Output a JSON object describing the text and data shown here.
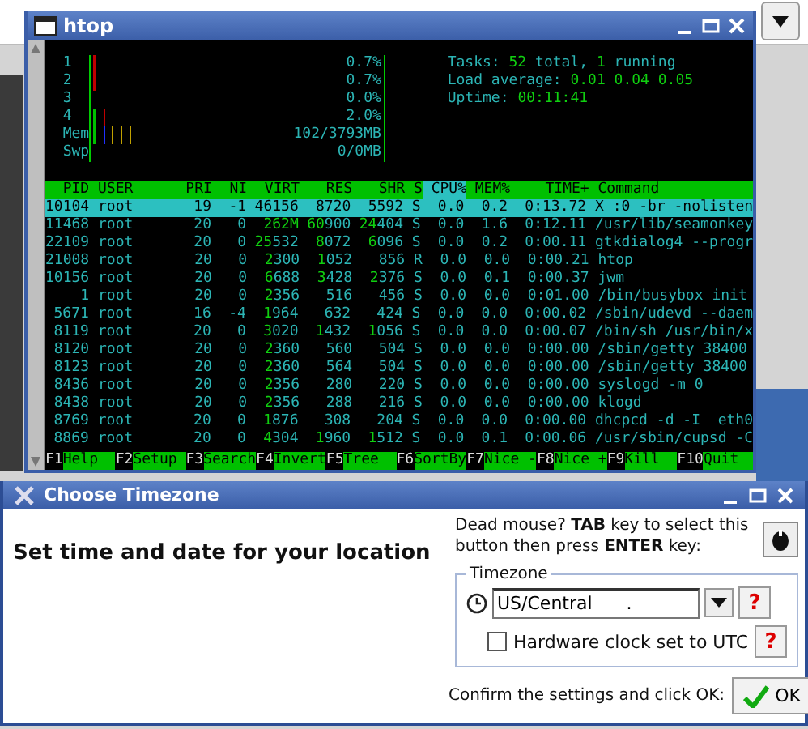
{
  "htop": {
    "title": "htop",
    "meters": [
      {
        "label": "1",
        "value": "0.7%",
        "segments": [
          {
            "color": "#c00000",
            "level": 0.03
          }
        ]
      },
      {
        "label": "2",
        "value": "0.7%",
        "segments": [
          {
            "color": "#c00000",
            "level": 0.03
          }
        ]
      },
      {
        "label": "3",
        "value": "0.0%"
      },
      {
        "label": "4",
        "value": "2.0%",
        "segments": [
          {
            "color": "#00c000",
            "level": 0.03
          },
          {
            "color": "#c00000",
            "level": 0.03
          }
        ]
      },
      {
        "label": "Mem",
        "value": "102/3793MB",
        "segments": [
          {
            "color": "#00c000",
            "level": 0.03
          },
          {
            "color": "#2030ff",
            "level": 0.03
          },
          {
            "color": "#c0a000",
            "level": 0.09
          }
        ]
      },
      {
        "label": "Swp",
        "value": "0/0MB"
      }
    ],
    "summary": [
      "Tasks: **52** total, **1** running",
      "Load average: **0.01 0.04 0.05**",
      "Uptime: **00:11:41**"
    ],
    "columns": [
      {
        "label": "PID",
        "sorted": false
      },
      {
        "label": "USER",
        "sorted": false
      },
      {
        "label": "PRI",
        "sorted": false
      },
      {
        "label": "NI",
        "sorted": false
      },
      {
        "label": "VIRT",
        "sorted": false
      },
      {
        "label": "RES",
        "sorted": false
      },
      {
        "label": "SHR",
        "sorted": false
      },
      {
        "label": "S",
        "sorted": false
      },
      {
        "label": "CPU%",
        "sorted": true
      },
      {
        "label": "MEM%",
        "sorted": false
      },
      {
        "label": "TIME+",
        "sorted": false
      },
      {
        "label": "Command",
        "sorted": false
      }
    ],
    "rows": [
      {
        "selected": true,
        "cells": [
          "10104",
          "root",
          "19",
          "-1",
          "46156",
          "8720",
          "5592",
          "S",
          "0.0",
          "0.2",
          "0:13.72",
          "X :0 -br -nolisten"
        ]
      },
      {
        "selected": false,
        "cells": [
          "11468",
          "root",
          "20",
          "0",
          "**262M**",
          "**60**900",
          "**24**404",
          "S",
          "0.0",
          "1.6",
          "0:12.11",
          "/usr/lib/seamonkey"
        ]
      },
      {
        "selected": false,
        "cells": [
          "22109",
          "root",
          "20",
          "0",
          "**25**532",
          "**8**072",
          "**6**096",
          "S",
          "0.0",
          "0.2",
          "0:00.11",
          "gtkdialog4 --progr"
        ]
      },
      {
        "selected": false,
        "cells": [
          "21008",
          "root",
          "20",
          "0",
          "**2**300",
          "**1**052",
          "856",
          "R",
          "0.0",
          "0.0",
          "0:00.21",
          "htop"
        ]
      },
      {
        "selected": false,
        "cells": [
          "10156",
          "root",
          "20",
          "0",
          "**6**688",
          "**3**428",
          "**2**376",
          "S",
          "0.0",
          "0.1",
          "0:00.37",
          "jwm"
        ]
      },
      {
        "selected": false,
        "cells": [
          "1",
          "root",
          "20",
          "0",
          "**2**356",
          "516",
          "456",
          "S",
          "0.0",
          "0.0",
          "0:01.00",
          "/bin/busybox init"
        ]
      },
      {
        "selected": false,
        "cells": [
          "5671",
          "root",
          "16",
          "-4",
          "**1**964",
          "632",
          "424",
          "S",
          "0.0",
          "0.0",
          "0:00.02",
          "/sbin/udevd --daem"
        ]
      },
      {
        "selected": false,
        "cells": [
          "8119",
          "root",
          "20",
          "0",
          "**3**020",
          "**1**432",
          "**1**056",
          "S",
          "0.0",
          "0.0",
          "0:00.07",
          "/bin/sh /usr/bin/x"
        ]
      },
      {
        "selected": false,
        "cells": [
          "8120",
          "root",
          "20",
          "0",
          "**2**360",
          "560",
          "504",
          "S",
          "0.0",
          "0.0",
          "0:00.00",
          "/sbin/getty 38400"
        ]
      },
      {
        "selected": false,
        "cells": [
          "8123",
          "root",
          "20",
          "0",
          "**2**360",
          "564",
          "504",
          "S",
          "0.0",
          "0.0",
          "0:00.00",
          "/sbin/getty 38400"
        ]
      },
      {
        "selected": false,
        "cells": [
          "8436",
          "root",
          "20",
          "0",
          "**2**356",
          "280",
          "220",
          "S",
          "0.0",
          "0.0",
          "0:00.00",
          "syslogd -m 0"
        ]
      },
      {
        "selected": false,
        "cells": [
          "8438",
          "root",
          "20",
          "0",
          "**2**356",
          "288",
          "216",
          "S",
          "0.0",
          "0.0",
          "0:00.00",
          "klogd"
        ]
      },
      {
        "selected": false,
        "cells": [
          "8769",
          "root",
          "20",
          "0",
          "**1**876",
          "308",
          "204",
          "S",
          "0.0",
          "0.0",
          "0:00.00",
          "dhcpcd -d -I  eth0"
        ]
      },
      {
        "selected": false,
        "cells": [
          "8869",
          "root",
          "20",
          "0",
          "**4**304",
          "**1**960",
          "**1**512",
          "S",
          "0.0",
          "0.1",
          "0:00.06",
          "/usr/sbin/cupsd -C"
        ]
      }
    ],
    "function_keys": [
      {
        "key": "F1",
        "label": "Help"
      },
      {
        "key": "F2",
        "label": "Setup"
      },
      {
        "key": "F3",
        "label": "Search"
      },
      {
        "key": "F4",
        "label": "Invert"
      },
      {
        "key": "F5",
        "label": "Tree"
      },
      {
        "key": "F6",
        "label": "SortBy"
      },
      {
        "key": "F7",
        "label": "Nice -"
      },
      {
        "key": "F8",
        "label": "Nice +"
      },
      {
        "key": "F9",
        "label": "Kill"
      },
      {
        "key": "F10",
        "label": "Quit"
      }
    ]
  },
  "dialog": {
    "title": "Choose Timezone",
    "heading": "Set time and date for your location",
    "hint": "Dead mouse? **TAB** key to select this button then press **ENTER** key:",
    "group": {
      "legend": "Timezone",
      "value": "US/Central      .",
      "help": "?",
      "checkbox": {
        "label": "Hardware clock set to UTC",
        "checked": false,
        "help": "?"
      }
    },
    "confirm": "Confirm the settings and click OK:",
    "ok": "OK"
  }
}
